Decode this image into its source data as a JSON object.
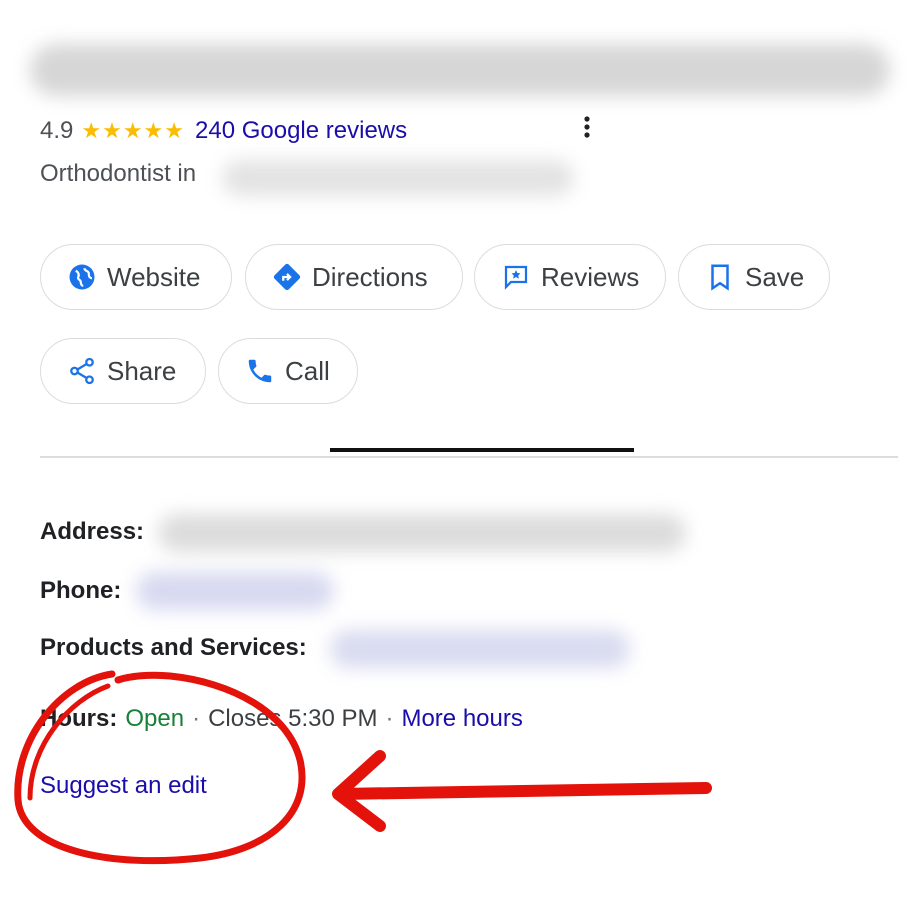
{
  "rating": {
    "score": "4.9",
    "stars": "★★★★★",
    "reviews_link": "240 Google reviews"
  },
  "category_prefix": "Orthodontist in",
  "actions": [
    {
      "label": "Website",
      "icon": "globe-icon"
    },
    {
      "label": "Directions",
      "icon": "directions-icon"
    },
    {
      "label": "Reviews",
      "icon": "reviews-icon"
    },
    {
      "label": "Save",
      "icon": "bookmark-icon"
    },
    {
      "label": "Share",
      "icon": "share-icon"
    },
    {
      "label": "Call",
      "icon": "phone-icon"
    }
  ],
  "info": {
    "address_label": "Address:",
    "phone_label": "Phone:",
    "products_label": "Products and Services:",
    "hours_label": "Hours:",
    "hours_status": "Open",
    "separator": "·",
    "closes_text": "Closes 5:30 PM",
    "more_hours": "More hours"
  },
  "suggest_edit": "Suggest an edit",
  "colors": {
    "link": "#1a0dab",
    "star": "#fbbc04",
    "open": "#188038",
    "icon_blue": "#1a73e8",
    "annotation_red": "#e3120b"
  }
}
